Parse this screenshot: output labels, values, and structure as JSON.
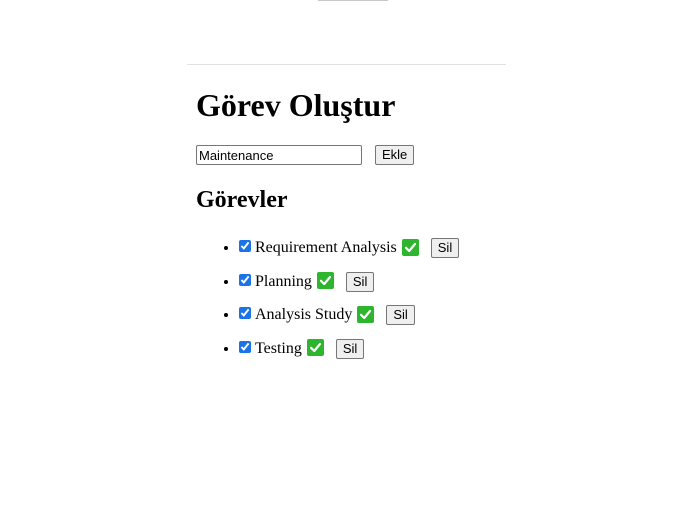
{
  "header": {
    "title": "Görev Oluştur"
  },
  "form": {
    "input_value": "Maintenance",
    "add_label": "Ekle"
  },
  "list": {
    "heading": "Görevler",
    "delete_label": "Sil",
    "items": [
      {
        "label": "Requirement Analysis",
        "done": true
      },
      {
        "label": "Planning",
        "done": true
      },
      {
        "label": "Analysis Study",
        "done": true
      },
      {
        "label": "Testing",
        "done": true
      }
    ]
  },
  "icons": {
    "done": "check-mark-button-icon"
  },
  "colors": {
    "done_icon_bg": "#2db52d",
    "checkbox_accent": "#1a73e8"
  }
}
